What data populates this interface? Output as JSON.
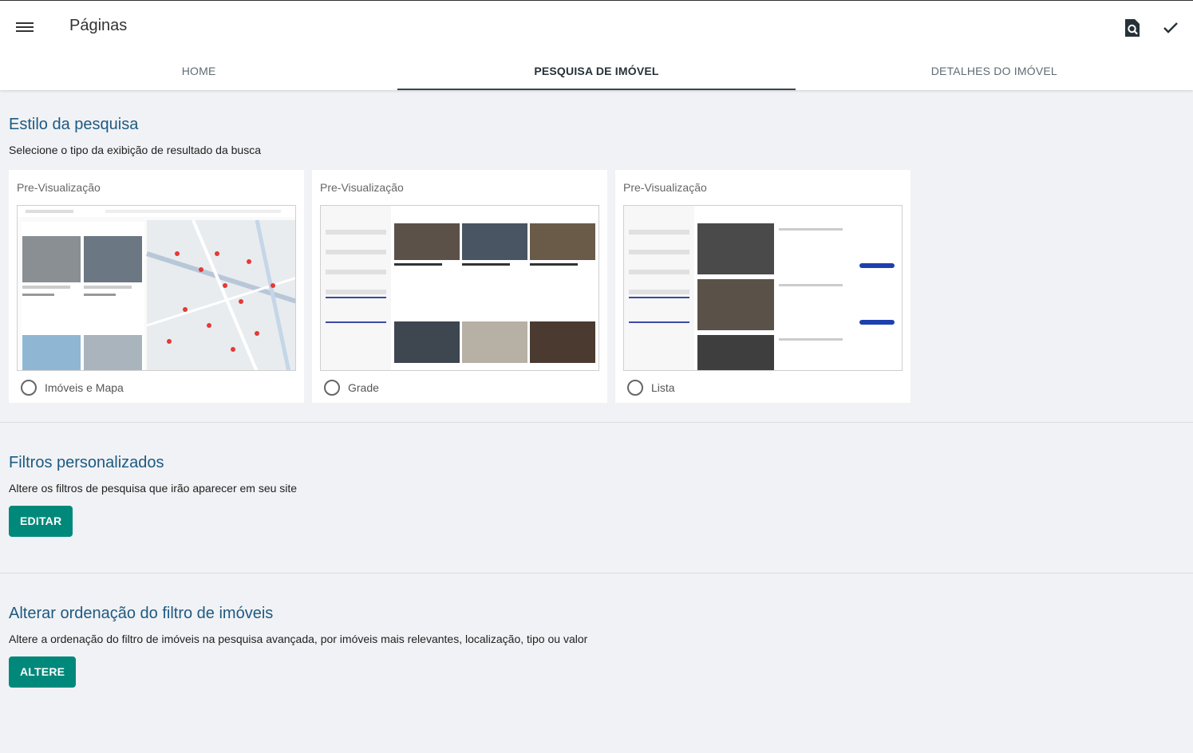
{
  "header": {
    "title": "Páginas",
    "menu_icon": "menu-icon",
    "preview_icon": "page-search-icon",
    "confirm_icon": "check-icon"
  },
  "tabs": [
    {
      "label": "HOME",
      "active": false
    },
    {
      "label": "PESQUISA DE IMÓVEL",
      "active": true
    },
    {
      "label": "DETALHES DO IMÓVEL",
      "active": false
    }
  ],
  "search_style": {
    "title": "Estilo da pesquisa",
    "subtitle": "Selecione o tipo da exibição de resultado da busca",
    "options": [
      {
        "preview_label": "Pre-Visualização",
        "option_label": "Imóveis e Mapa"
      },
      {
        "preview_label": "Pre-Visualização",
        "option_label": "Grade"
      },
      {
        "preview_label": "Pre-Visualização",
        "option_label": "Lista"
      }
    ]
  },
  "custom_filters": {
    "title": "Filtros personalizados",
    "subtitle": "Altere os filtros de pesquisa que irão aparecer em seu site",
    "button": "EDITAR"
  },
  "ordering": {
    "title": "Alterar ordenação do filtro de imóveis",
    "subtitle": "Altere a ordenação do filtro de imóveis na pesquisa avançada, por imóveis mais relevantes, localização, tipo ou valor",
    "button": "ALTERE"
  },
  "colors": {
    "accent": "#00897b",
    "title": "#1d5a82",
    "background": "#f1f2f5"
  }
}
